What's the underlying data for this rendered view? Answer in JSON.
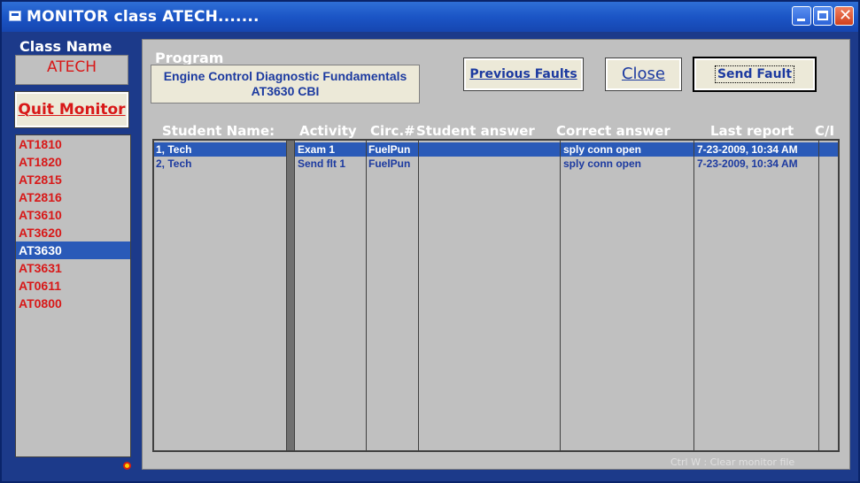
{
  "window": {
    "title": "MONITOR class ATECH......."
  },
  "left": {
    "class_name_label": "Class Name",
    "class_name_value": "ATECH",
    "quit_button": "Quit Monitor",
    "classes": [
      "AT1810",
      "AT1820",
      "AT2815",
      "AT2816",
      "AT3610",
      "AT3620",
      "AT3630",
      "AT3631",
      "AT0611",
      "AT0800"
    ],
    "selected_class": "AT3630"
  },
  "program": {
    "label": "Program",
    "line1": "Engine Control Diagnostic Fundamentals",
    "line2": "AT3630 CBI"
  },
  "buttons": {
    "previous_faults": "Previous Faults",
    "close": "Close",
    "send_fault": "Send Fault"
  },
  "table": {
    "headers": [
      "Student Name:",
      "Activity",
      "Circ.#",
      "Student answer",
      "Correct answer",
      "Last report",
      "C/I"
    ],
    "rows": [
      {
        "student": "1, Tech",
        "activity": "Exam 1",
        "circ": "FuelPun",
        "student_answer": "",
        "correct_answer": "sply conn open",
        "last_report": "7-23-2009, 10:34 AM",
        "ci": ""
      },
      {
        "student": "2, Tech",
        "activity": "Send flt 1",
        "circ": "FuelPun",
        "student_answer": "",
        "correct_answer": "sply conn open",
        "last_report": "7-23-2009, 10:34 AM",
        "ci": ""
      }
    ]
  },
  "footer_note": "Ctrl W : Clear monitor file",
  "colors": {
    "titlebar": "#1b55c6",
    "panel": "#c0c0c0",
    "window_bg": "#1c3a8a",
    "class_text": "#d81818",
    "selection": "#2a5ab8",
    "row_text": "#1c3aa0"
  }
}
